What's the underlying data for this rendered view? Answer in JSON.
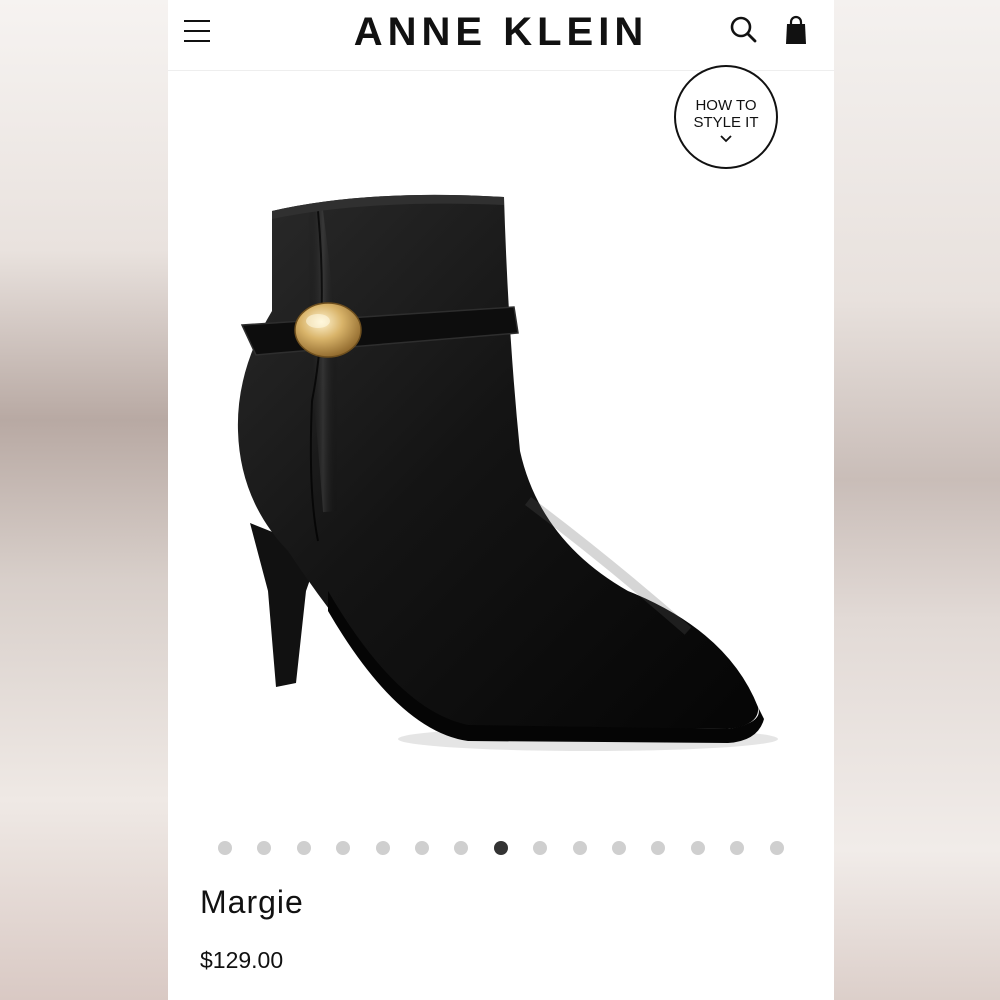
{
  "header": {
    "brand": "ANNE KLEIN",
    "menu_icon": "hamburger-menu-icon",
    "search_icon": "search-icon",
    "bag_icon": "shopping-bag-icon"
  },
  "hero": {
    "image_alt": "Black leather pointed-toe ankle boot with gold oval buckle strap",
    "how_to": {
      "line1": "HOW TO",
      "line2": "STYLE IT",
      "icon": "chevron-down-icon"
    }
  },
  "carousel": {
    "total": 15,
    "active_index": 7
  },
  "product": {
    "name": "Margie",
    "price": "$129.00"
  },
  "colors": {
    "accent": "#111111",
    "dot_inactive": "#cfcfcf",
    "dot_active": "#333333"
  }
}
